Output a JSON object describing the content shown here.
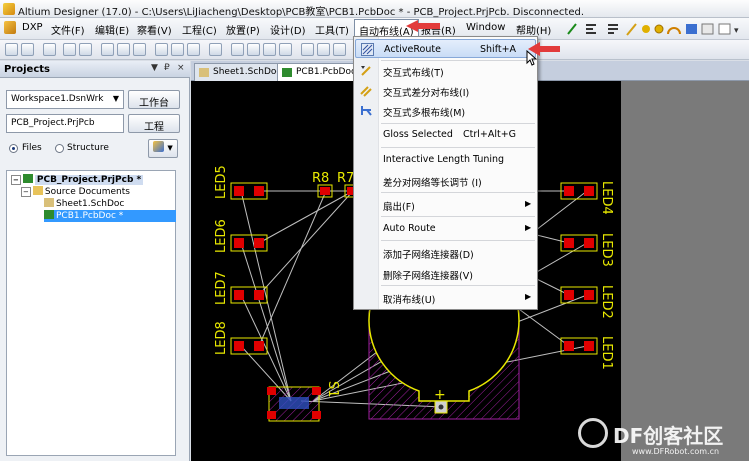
{
  "window": {
    "title": "Altium Designer (17.0) - C:\\Users\\LiJiacheng\\Desktop\\PCB教室\\PCB1.PcbDoc * - PCB_Project.PrjPcb. Disconnected."
  },
  "menubar": [
    {
      "label": "DXP"
    },
    {
      "label": "文件(F)"
    },
    {
      "label": "编辑(E)"
    },
    {
      "label": "察看(V)"
    },
    {
      "label": "工程(C)"
    },
    {
      "label": "放置(P)"
    },
    {
      "label": "设计(D)"
    },
    {
      "label": "工具(T)"
    },
    {
      "label": "自动布线(A)"
    },
    {
      "label": "报告(R)"
    },
    {
      "label": "Window"
    },
    {
      "label": "帮助(H)"
    }
  ],
  "projects_panel": {
    "title": "Projects",
    "header_buttons": [
      "▼",
      "₽",
      "×"
    ],
    "workspace_value": "Workspace1.DsnWrk",
    "workspace_button": "工作台",
    "project_value": "PCB_Project.PrjPcb",
    "project_button": "工程",
    "radio_files": "Files",
    "radio_structure": "Structure",
    "tree": [
      {
        "label": "PCB_Project.PrjPcb *"
      },
      {
        "label": "Source Documents"
      },
      {
        "label": "Sheet1.SchDoc"
      },
      {
        "label": "PCB1.PcbDoc *"
      }
    ]
  },
  "doc_tabs": [
    {
      "label": "Sheet1.SchDoc"
    },
    {
      "label": "PCB1.PcbDoc *"
    }
  ],
  "pcb": {
    "labels": [
      "LED5",
      "LED6",
      "LED7",
      "LED8",
      "LED4",
      "LED3",
      "LED2",
      "LED1",
      "R8",
      "R7",
      "S1"
    ],
    "colors": {
      "silk": "#e8e800",
      "pad": "#e00000",
      "board": "#000000",
      "keepout": "#a020a0"
    }
  },
  "dropdown_menu": {
    "items": [
      {
        "label": "ActiveRoute",
        "shortcut": "Shift+A",
        "icon": "active-route-icon",
        "highlighted": true
      },
      {
        "label": "交互式布线(T)",
        "icon": "interactive-route-icon"
      },
      {
        "label": "交互式差分对布线(I)",
        "icon": "diff-pair-route-icon"
      },
      {
        "label": "交互式多根布线(M)",
        "icon": "multi-route-icon"
      },
      {
        "label": "Gloss Selected",
        "shortcut": "Ctrl+Alt+G"
      },
      {
        "label": "Interactive Length Tuning"
      },
      {
        "label": "差分对网络等长调节 (I)"
      },
      {
        "label": "扇出(F)",
        "submenu": true
      },
      {
        "label": "Auto Route",
        "submenu": true
      },
      {
        "label": "添加子网络连接器(D)"
      },
      {
        "label": "删除子网络连接器(V)"
      },
      {
        "label": "取消布线(U)",
        "submenu": true
      }
    ]
  },
  "watermark": {
    "text": "DF创客社区",
    "url": "www.DFRobot.com.cn"
  },
  "colors": {
    "highlight_arrow": "#e23b3b"
  }
}
